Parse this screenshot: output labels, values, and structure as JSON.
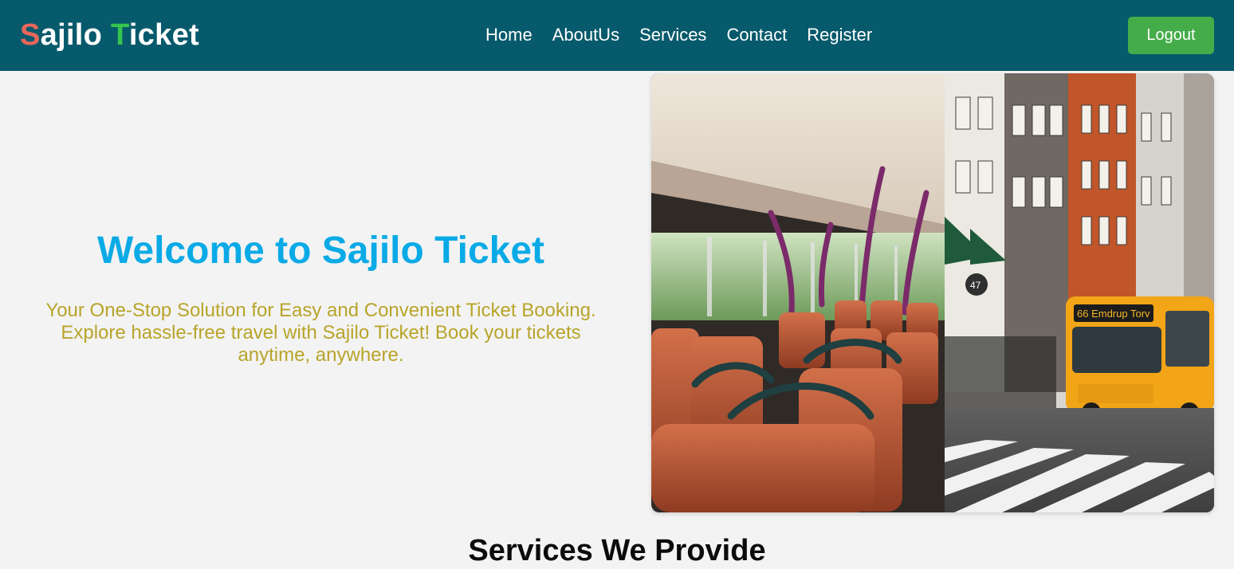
{
  "brand": {
    "first_letter": "S",
    "rest1": "ajilo ",
    "second_letter": "T",
    "rest2": "icket"
  },
  "nav": {
    "links": [
      "Home",
      "AboutUs",
      "Services",
      "Contact",
      "Register"
    ],
    "logout_label": "Logout"
  },
  "hero": {
    "title": "Welcome to Sajilo Ticket",
    "subtitle": "Your One-Stop Solution for Easy and Convenient Ticket Booking. Explore hassle-free travel with Sajilo Ticket! Book your tickets anytime, anywhere.",
    "image": {
      "bus_route_sign": "66 Emdrup Torv",
      "house_number": "47"
    }
  },
  "services": {
    "title": "Services We Provide"
  },
  "colors": {
    "navbar": "#075a6b",
    "logo_s": "#e8665a",
    "logo_t": "#35c44d",
    "logout": "#44ac49",
    "hero_title": "#0aaae6",
    "hero_subtitle": "#b8a42a"
  }
}
